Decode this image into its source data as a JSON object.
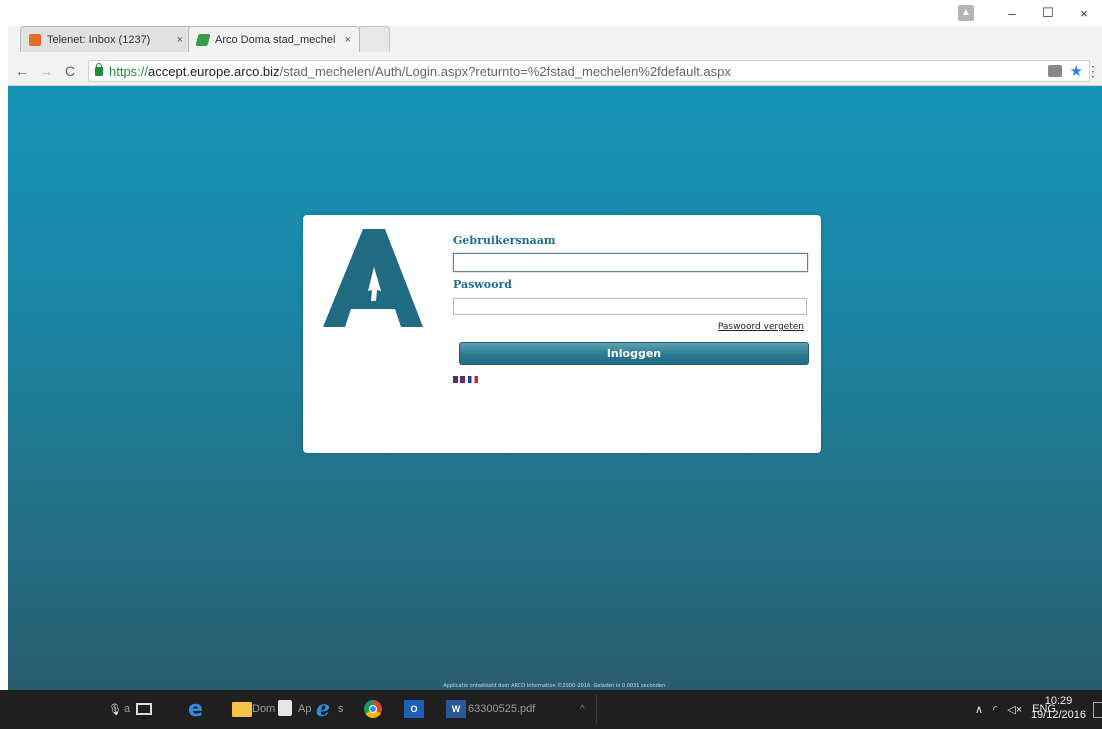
{
  "browser": {
    "tabs": [
      {
        "title": "Telenet: Inbox (1237)",
        "close": "×",
        "active": false
      },
      {
        "title": "Arco Doma stad_mechel",
        "close": "×",
        "active": true
      }
    ],
    "window_controls": {
      "minimize": "–",
      "maximize": "☐",
      "close": "×"
    },
    "nav": {
      "back": "←",
      "forward": "→",
      "reload": "C"
    },
    "url": {
      "scheme": "https://",
      "host": "accept.europe.arco.biz",
      "path": "/stad_mechelen/Auth/Login.aspx?returnto=%2fstad_mechelen%2fdefault.aspx"
    },
    "menu": "⋮"
  },
  "login": {
    "username_label": "Gebruikersnaam",
    "username_value": "",
    "password_label": "Paswoord",
    "password_value": "",
    "forgot_link": "Paswoord vergeten",
    "submit_label": "Inloggen",
    "languages": [
      "en",
      "fr"
    ]
  },
  "footer": {
    "text": "Applicatie ontwikkeld door ARCO Information ©2000–2016. Geladen in 0.0031 seconden."
  },
  "taskbar": {
    "search_text": "a",
    "folder_label": "Dom",
    "app_label": "Ap",
    "app2_label": "s",
    "pdf_label": "63300525.pdf",
    "outlook_badge": "O",
    "word_badge": "W",
    "tray_lang": "ENG",
    "time": "10:29",
    "date": "19/12/2016"
  },
  "colors": {
    "page_top": "#1793b8",
    "page_bottom": "#285d6e",
    "label_blue": "#1d6f8f",
    "button": "#2b7a92"
  }
}
